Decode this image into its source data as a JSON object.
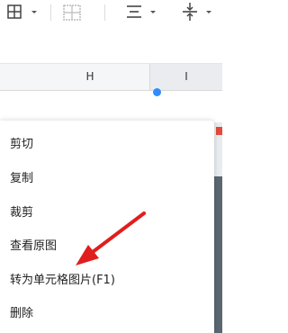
{
  "toolbar": {
    "icons": [
      "table-grid-icon",
      "dropdown-caret-icon",
      "merge-cells-icon",
      "align-center-icon",
      "dropdown-caret-icon",
      "vertical-center-icon",
      "dropdown-caret-icon"
    ]
  },
  "columns": {
    "h_label": "H",
    "i_label": "I"
  },
  "context_menu": {
    "items": [
      {
        "label": "剪切"
      },
      {
        "label": "复制"
      },
      {
        "label": "裁剪"
      },
      {
        "label": "查看原图"
      },
      {
        "label": "转为单元格图片(F1)"
      },
      {
        "label": "删除"
      }
    ]
  },
  "colors": {
    "annotation_arrow": "#e01e1e",
    "selection_accent": "#2f8cff"
  }
}
